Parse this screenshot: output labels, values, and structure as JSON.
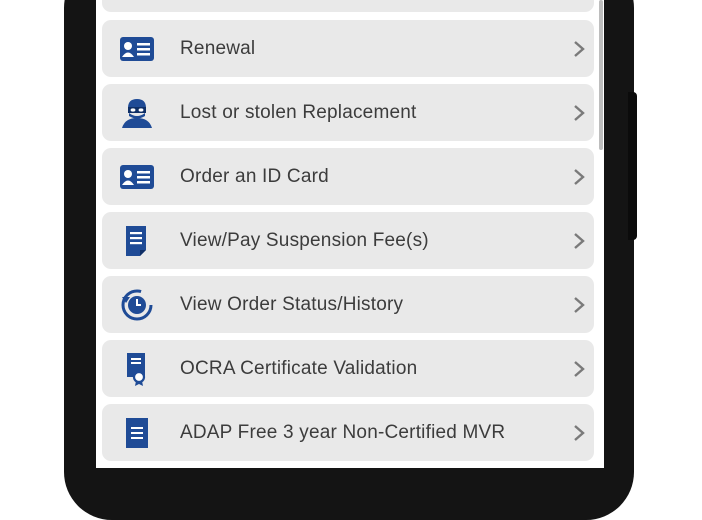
{
  "menu": {
    "items": [
      {
        "label": "Renewal",
        "icon": "id-card-icon"
      },
      {
        "label": "Lost or stolen Replacement",
        "icon": "burglar-icon"
      },
      {
        "label": "Order an ID Card",
        "icon": "id-card-icon"
      },
      {
        "label": "View/Pay Suspension Fee(s)",
        "icon": "document-icon"
      },
      {
        "label": "View Order Status/History",
        "icon": "clock-history-icon"
      },
      {
        "label": "OCRA Certificate Validation",
        "icon": "certificate-icon"
      },
      {
        "label": "ADAP Free 3 year Non-Certified MVR",
        "icon": "document-lines-icon"
      }
    ]
  },
  "colors": {
    "icon_blue": "#1f4b96",
    "row_bg": "#e9e9e9",
    "label_text": "#3c3c3c",
    "chevron": "#7a7a7a"
  }
}
